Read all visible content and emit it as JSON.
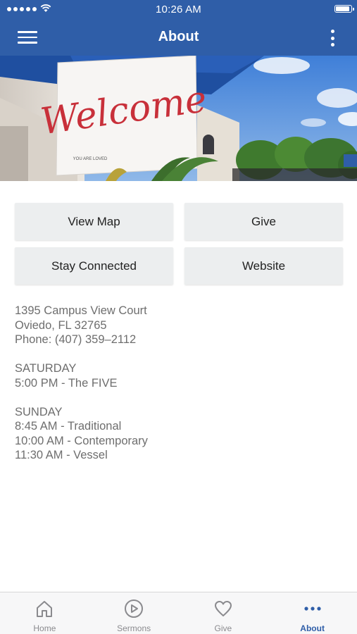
{
  "status_bar": {
    "time": "10:26 AM",
    "signal_bars": 5,
    "battery_level": 0.95
  },
  "header": {
    "title": "About",
    "menu_icon": "hamburger-icon",
    "more_icon": "more-vertical-icon"
  },
  "hero": {
    "banner_word": "Welcome",
    "banner_small_text": "YOU ARE LOVED"
  },
  "buttons": {
    "view_map": "View Map",
    "give": "Give",
    "stay_connected": "Stay Connected",
    "website": "Website"
  },
  "info": {
    "address_line1": "1395 Campus View Court",
    "address_line2": "Oviedo, FL 32765",
    "phone": "Phone: (407) 359–2112",
    "saturday": {
      "heading": "SATURDAY",
      "services": [
        "5:00 PM - The FIVE"
      ]
    },
    "sunday": {
      "heading": "SUNDAY",
      "services": [
        "8:45 AM - Traditional",
        "10:00 AM - Contemporary",
        "11:30 AM - Vessel"
      ]
    }
  },
  "tabs": [
    {
      "label": "Home",
      "icon": "home-icon",
      "active": false
    },
    {
      "label": "Sermons",
      "icon": "play-circle-icon",
      "active": false
    },
    {
      "label": "Give",
      "icon": "heart-icon",
      "active": false
    },
    {
      "label": "About",
      "icon": "more-horizontal-icon",
      "active": true
    }
  ],
  "colors": {
    "brand_blue": "#2f5ea8",
    "button_bg": "#eceeef",
    "body_text": "#6e6e6e",
    "tab_inactive": "#8a8a8e",
    "banner_red": "#c8303a"
  }
}
